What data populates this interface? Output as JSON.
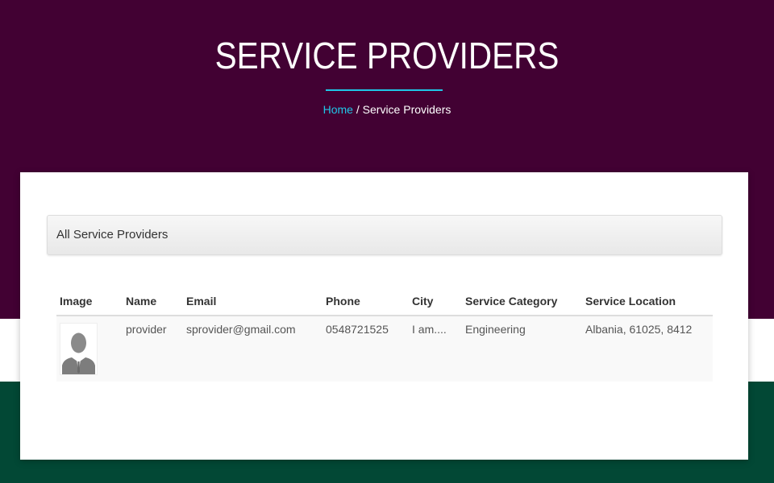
{
  "hero": {
    "title": "SERVICE PROVIDERS",
    "breadcrumb_home": "Home",
    "breadcrumb_sep": " / ",
    "breadcrumb_current": "Service Providers"
  },
  "panel": {
    "heading": "All Service Providers"
  },
  "table": {
    "headers": [
      "Image",
      "Name",
      "Email",
      "Phone",
      "City",
      "Service Category",
      "Service Location"
    ],
    "rows": [
      {
        "image_icon": "avatar-silhouette-icon",
        "name": "provider",
        "email": "sprovider@gmail.com",
        "phone": "0548721525",
        "city": "I am....",
        "service_category": "Engineering",
        "service_location": "Albania, 61025, 8412"
      }
    ]
  },
  "colors": {
    "hero_bg": "#420133",
    "footer_bg": "#024835",
    "accent": "#1fc7e8"
  }
}
